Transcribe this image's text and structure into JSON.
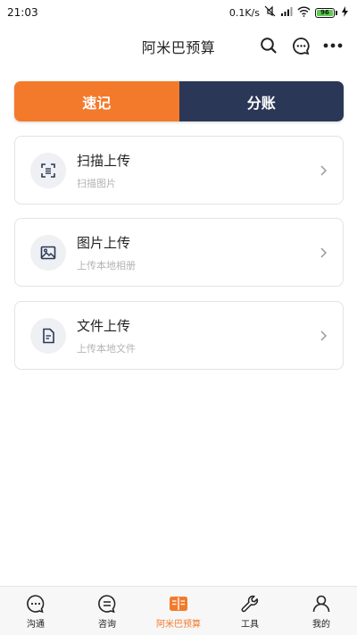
{
  "status": {
    "time": "21:03",
    "speed": "0.1K/s",
    "battery": "96"
  },
  "header": {
    "title": "阿米巴预算"
  },
  "segment": {
    "left_label": "速记",
    "right_label": "分账"
  },
  "cards": [
    {
      "title": "扫描上传",
      "subtitle": "扫描图片"
    },
    {
      "title": "图片上传",
      "subtitle": "上传本地相册"
    },
    {
      "title": "文件上传",
      "subtitle": "上传本地文件"
    }
  ],
  "nav": {
    "items": [
      {
        "label": "沟通"
      },
      {
        "label": "咨询"
      },
      {
        "label": "阿米巴预算"
      },
      {
        "label": "工具"
      },
      {
        "label": "我的"
      }
    ]
  },
  "colors": {
    "accent": "#f47a2b",
    "navy": "#2b3756"
  }
}
